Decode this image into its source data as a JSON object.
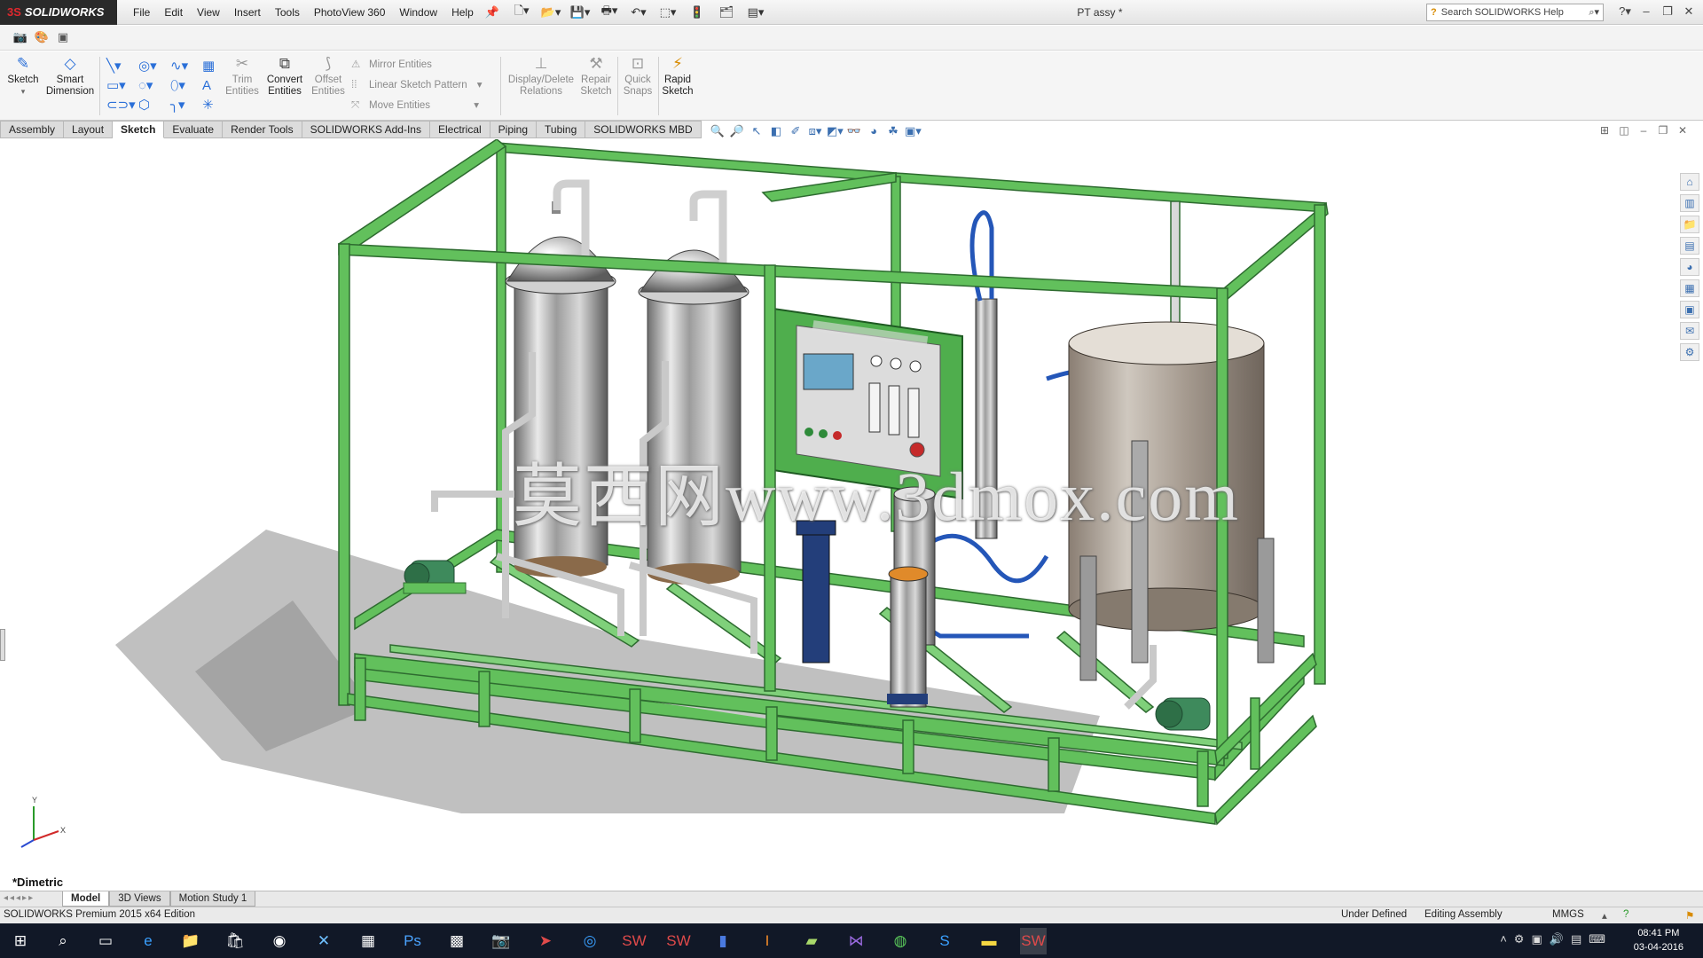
{
  "app": {
    "logo": "SOLIDWORKS",
    "menu": [
      "File",
      "Edit",
      "View",
      "Insert",
      "Tools",
      "PhotoView 360",
      "Window",
      "Help"
    ],
    "document_title": "PT assy *",
    "search_placeholder": "Search SOLIDWORKS Help"
  },
  "ribbon": {
    "sketch": "Sketch",
    "smart_dimension": "Smart Dimension",
    "trim_entities": "Trim Entities",
    "convert_entities": "Convert Entities",
    "offset_entities": "Offset Entities",
    "mirror_entities": "Mirror Entities",
    "linear_sketch_pattern": "Linear Sketch Pattern",
    "move_entities": "Move Entities",
    "display_delete_relations": "Display/Delete Relations",
    "repair_sketch": "Repair Sketch",
    "quick_snaps": "Quick Snaps",
    "rapid_sketch": "Rapid Sketch"
  },
  "tabs": [
    {
      "label": "Assembly",
      "active": false
    },
    {
      "label": "Layout",
      "active": false
    },
    {
      "label": "Sketch",
      "active": true
    },
    {
      "label": "Evaluate",
      "active": false
    },
    {
      "label": "Render Tools",
      "active": false
    },
    {
      "label": "SOLIDWORKS Add-Ins",
      "active": false
    },
    {
      "label": "Electrical",
      "active": false
    },
    {
      "label": "Piping",
      "active": false
    },
    {
      "label": "Tubing",
      "active": false
    },
    {
      "label": "SOLIDWORKS MBD",
      "active": false
    }
  ],
  "viewport": {
    "orientation_label": "*Dimetric",
    "watermark": "莫西网www.3dmox.com"
  },
  "bottom_tabs": [
    {
      "label": "Model",
      "active": true
    },
    {
      "label": "3D Views",
      "active": false
    },
    {
      "label": "Motion Study 1",
      "active": false
    }
  ],
  "status": {
    "edition": "SOLIDWORKS Premium 2015 x64 Edition",
    "sketch_state": "Under Defined",
    "mode": "Editing Assembly",
    "units": "MMGS"
  },
  "taskbar": {
    "time": "08:41 PM",
    "date": "03-04-2016"
  },
  "colors": {
    "frame_green": "#5fbf5a",
    "frame_dark": "#2f7a33",
    "accent_blue": "#2a6fd8"
  }
}
